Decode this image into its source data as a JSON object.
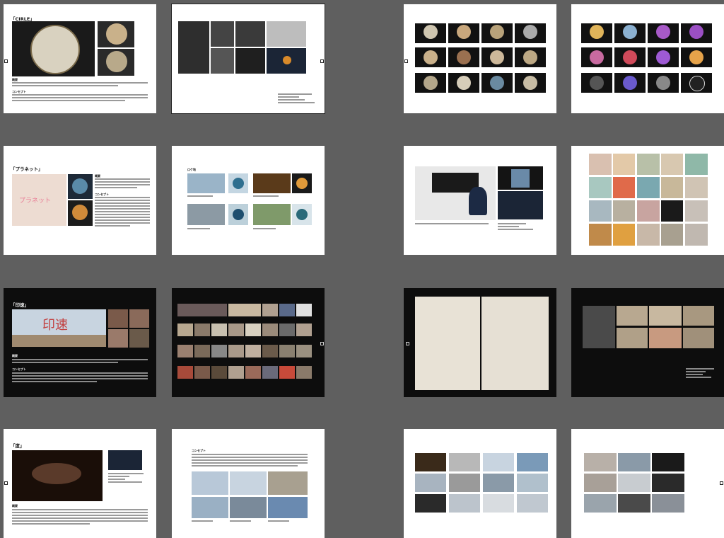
{
  "pages": {
    "circle": {
      "title": "「CIRLE」"
    },
    "planet": {
      "title": "「プラネット」",
      "overlay": "プラネット",
      "side_heading_1": "概要",
      "side_heading_2": "コンセプト"
    },
    "location": {
      "heading": "ロケ地"
    },
    "inshoku": {
      "title": "「印速」",
      "overlay": "印速"
    },
    "do": {
      "title": "「度」"
    },
    "concept": {
      "heading": "コンセプト"
    }
  },
  "common": {
    "heading_overview": "概要",
    "heading_concept": "コンセプト"
  }
}
